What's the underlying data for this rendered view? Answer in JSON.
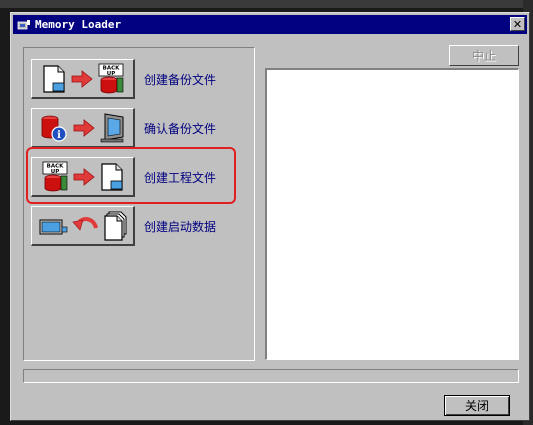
{
  "window": {
    "title": "Memory Loader",
    "close_glyph": "✕"
  },
  "toolbar": {
    "stop_label": "中止"
  },
  "actions": [
    {
      "label": "创建备份文件",
      "icons": [
        "document-icon",
        "arrow-right-icon",
        "backup-icon"
      ]
    },
    {
      "label": "确认备份文件",
      "icons": [
        "database-check-icon",
        "arrow-right-icon",
        "monitor-icon"
      ]
    },
    {
      "label": "创建工程文件",
      "icons": [
        "backup-icon",
        "arrow-right-icon",
        "document-icon"
      ]
    },
    {
      "label": "创建启动数据",
      "icons": [
        "device-icon",
        "curved-arrow-icon",
        "documents-icon"
      ]
    }
  ],
  "footer": {
    "close_label": "关闭"
  },
  "colors": {
    "titlebar": "#000080",
    "highlight": "#e02020",
    "arrow": "#e03a3a",
    "backup_red": "#cc1010"
  },
  "backup_icon_text": {
    "line1": "BACK",
    "line2": "UP"
  }
}
